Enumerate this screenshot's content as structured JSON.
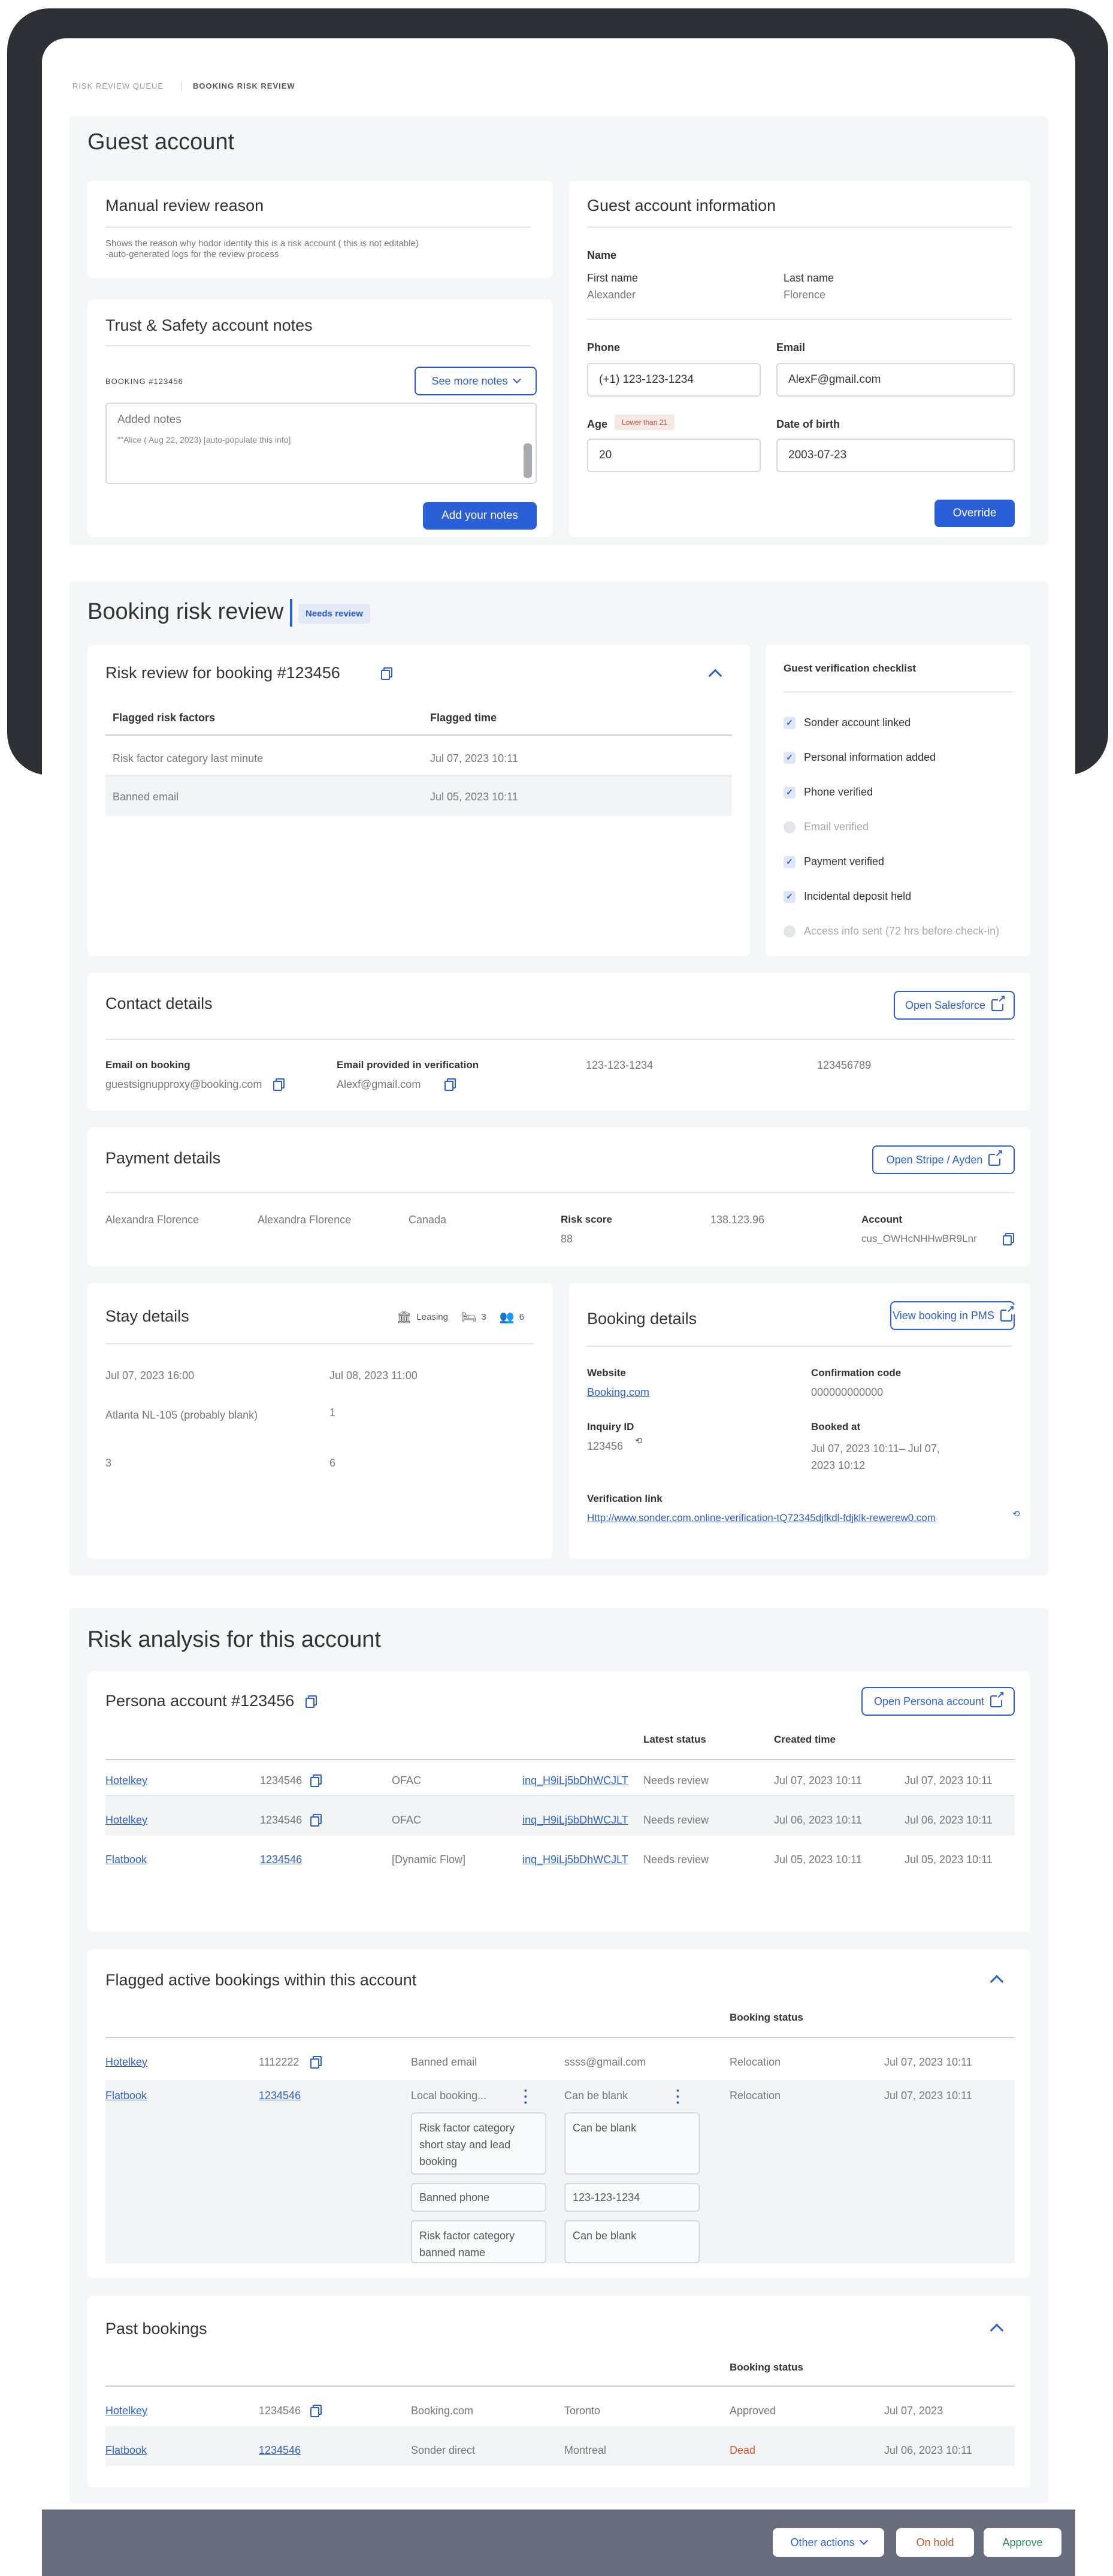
{
  "breadcrumb": {
    "queue": "RISK REVIEW QUEUE",
    "current": "BOOKING RISK REVIEW"
  },
  "guest_account": {
    "title": "Guest account",
    "manual_review": {
      "title": "Manual review reason",
      "description": "Shows the reason why hodor identity this is a risk account ( this is not editable)\n-auto-generated logs for the review process"
    },
    "notes": {
      "title": "Trust & Safety account notes",
      "booking_label": "BOOKING #123456",
      "see_more": "See more notes",
      "textarea_title": "Added notes",
      "textarea_log": "\"\"Alice ( Aug 22, 2023) [auto-populate this info]",
      "add_button": "Add your notes"
    },
    "info": {
      "title": "Guest account information",
      "name_label": "Name",
      "first_name_label": "First name",
      "first_name": "Alexander",
      "last_name_label": "Last name",
      "last_name": "Florence",
      "phone_label": "Phone",
      "phone": "(+1) 123-123-1234",
      "email_label": "Email",
      "email": "AlexF@gmail.com",
      "age_label": "Age",
      "age_badge": "Lower than 21",
      "age": "20",
      "dob_label": "Date of birth",
      "dob": "2003-07-23",
      "override": "Override"
    }
  },
  "booking_review": {
    "title": "Booking risk review",
    "status": "Needs review",
    "risk": {
      "title": "Risk review for booking #123456",
      "col_factors": "Flagged risk factors",
      "col_time": "Flagged time",
      "rows": [
        {
          "factor": "Risk factor category last minute",
          "time": "Jul 07, 2023 10:11"
        },
        {
          "factor": "Banned email",
          "time": "Jul 05, 2023 10:11"
        }
      ]
    },
    "checklist": {
      "title": "Guest verification checklist",
      "items": [
        {
          "label": "Sonder account linked",
          "done": true
        },
        {
          "label": "Personal information added",
          "done": true
        },
        {
          "label": "Phone verified",
          "done": true
        },
        {
          "label": "Email verified",
          "done": false
        },
        {
          "label": "Payment verified",
          "done": true
        },
        {
          "label": "Incidental deposit held",
          "done": true
        },
        {
          "label": "Access info sent (72 hrs before check-in)",
          "done": false
        }
      ]
    },
    "contact": {
      "title": "Contact details",
      "button": "Open Salesforce",
      "email_booking_label": "Email on booking",
      "email_booking": "guestsignupproxy@booking.com",
      "email_verif_label": "Email provided in verification",
      "email_verif": "Alexf@gmail.com",
      "phone": "123-123-1234",
      "number": "123456789"
    },
    "payment": {
      "title": "Payment details",
      "button": "Open Stripe / Ayden",
      "name1": "Alexandra Florence",
      "name2": "Alexandra Florence",
      "country": "Canada",
      "risk_label": "Risk score",
      "risk_value": "88",
      "ip": "138.123.96",
      "account_label": "Account",
      "account": "cus_OWHcNHHwBR9Lnr"
    },
    "stay": {
      "title": "Stay details",
      "type": "Leasing",
      "beds": "3",
      "guests": "6",
      "checkin": "Jul 07, 2023 16:00",
      "checkout": "Jul 08, 2023 11:00",
      "location": "Atlanta NL-105  (probably blank)",
      "v1": "1",
      "v2": "3",
      "v3": "6"
    },
    "booking": {
      "title": "Booking details",
      "button": "View booking in PMS",
      "website_label": "Website",
      "website": "Booking.com",
      "conf_label": "Confirmation code",
      "conf": "000000000000",
      "inquiry_label": "Inquiry ID",
      "inquiry": "123456",
      "booked_label": "Booked at",
      "booked": "Jul 07, 2023 10:11– Jul 07,\n2023 10:12",
      "verif_label": "Verification link",
      "verif": "Http://www.sonder.com.online-verification-tQ72345djfkdl-fdjklk-rewerew0.com"
    }
  },
  "risk_analysis": {
    "title": "Risk analysis for this account",
    "persona": {
      "title": "Persona account #123456",
      "button": "Open Persona account",
      "col_status": "Latest status",
      "col_created": "Created time",
      "rows": [
        {
          "source": "Hotelkey",
          "id": "1234546",
          "type": "OFAC",
          "inq": "inq_H9iLj5bDhWCJLT",
          "status": "Needs review",
          "created": "Jul 07, 2023 10:11",
          "time": "Jul 07, 2023 10:11"
        },
        {
          "source": "Hotelkey",
          "id": "1234546",
          "type": "OFAC",
          "inq": "inq_H9iLj5bDhWCJLT",
          "status": "Needs review",
          "created": "Jul 06, 2023 10:11",
          "time": "Jul 06, 2023 10:11"
        },
        {
          "source": "Flatbook",
          "id": "1234546",
          "type": "[Dynamic Flow]",
          "inq": "inq_H9iLj5bDhWCJLT",
          "status": "Needs review",
          "created": "Jul 05, 2023 10:11",
          "time": "Jul 05, 2023 10:11"
        }
      ]
    },
    "flagged": {
      "title": "Flagged active bookings within this account",
      "col_status": "Booking status",
      "row1": {
        "source": "Hotelkey",
        "id": "1112222",
        "factor": "Banned email",
        "value": "ssss@gmail.com",
        "status": "Relocation",
        "time": "Jul 07, 2023 10:11"
      },
      "row2": {
        "source": "Flatbook",
        "id": "1234546",
        "factor": "Local booking...",
        "value": "Can be blank",
        "status": "Relocation",
        "time": "Jul 07, 2023 10:11",
        "factors": [
          "Risk factor category short stay and lead booking",
          "Banned phone",
          "Risk factor category banned name"
        ],
        "values": [
          "Can be blank",
          "123-123-1234",
          "Can be blank"
        ]
      }
    },
    "past": {
      "title": "Past bookings",
      "col_status": "Booking status",
      "rows": [
        {
          "source": "Hotelkey",
          "id": "1234546",
          "channel": "Booking.com",
          "city": "Toronto",
          "status": "Approved",
          "time": "Jul 07, 2023"
        },
        {
          "source": "Flatbook",
          "id": "1234546",
          "channel": "Sonder direct",
          "city": "Montreal",
          "status": "Dead",
          "time": "Jul 06, 2023 10:11"
        }
      ]
    }
  },
  "footer": {
    "other": "Other actions",
    "hold": "On hold",
    "approve": "Approve"
  },
  "colors": {
    "primary": "#2a5fd8",
    "dead": "#d2582e",
    "approve": "#2e8a60",
    "hold": "#c0572e"
  }
}
